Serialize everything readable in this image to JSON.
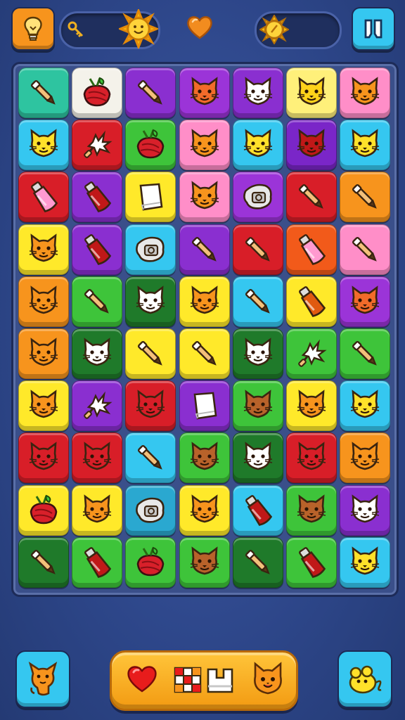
{
  "theme": {
    "bg": "#2d4689",
    "board": "#3a4f8a",
    "accent_orange": "#f7941d",
    "accent_cyan": "#35c7f0"
  },
  "top_bar": {
    "hint_button": {
      "icon": "lightbulb-icon",
      "color": "#f7941d"
    },
    "left_counter": {
      "icons": [
        "key-icon",
        "sun-icon"
      ]
    },
    "heart": {
      "icon": "heart-icon",
      "color": "#f28c1f"
    },
    "right_counter": {
      "icons": [
        "coin-icon"
      ]
    },
    "pause_button": {
      "icon": "pause-icon",
      "color": "#35c7f0"
    }
  },
  "board": {
    "rows": 10,
    "cols": 7,
    "tiles": [
      [
        [
          "#2ec4a0",
          "brush"
        ],
        [
          "#f4f2ea",
          "berry"
        ],
        [
          "#8a2fd0",
          "brush"
        ],
        [
          "#9b34d8",
          "cat"
        ],
        [
          "#8a2fd0",
          "cat"
        ],
        [
          "#fff07a",
          "cat"
        ],
        [
          "#ff8ec8",
          "cat"
        ]
      ],
      [
        [
          "#35c7f0",
          "cat"
        ],
        [
          "#d81e28",
          "splat"
        ],
        [
          "#3ec43a",
          "berry"
        ],
        [
          "#ff8ec8",
          "cat"
        ],
        [
          "#35c7f0",
          "cat"
        ],
        [
          "#7a26c8",
          "cat"
        ],
        [
          "#35c7f0",
          "cat"
        ]
      ],
      [
        [
          "#d81e28",
          "bottle"
        ],
        [
          "#8a2fd0",
          "bottle"
        ],
        [
          "#ffe92a",
          "paper"
        ],
        [
          "#ff8ec8",
          "cat"
        ],
        [
          "#9b34d8",
          "toy"
        ],
        [
          "#d81e28",
          "brush"
        ],
        [
          "#f7941d",
          "brush"
        ]
      ],
      [
        [
          "#ffe92a",
          "cat"
        ],
        [
          "#8a2fd0",
          "bottle"
        ],
        [
          "#35c7f0",
          "toy"
        ],
        [
          "#8a2fd0",
          "brush"
        ],
        [
          "#d81e28",
          "brush"
        ],
        [
          "#f25a1a",
          "bottle"
        ],
        [
          "#ff8ec8",
          "brush"
        ]
      ],
      [
        [
          "#f7941d",
          "cat"
        ],
        [
          "#3ec43a",
          "brush"
        ],
        [
          "#1f7a2a",
          "cat"
        ],
        [
          "#ffe92a",
          "cat"
        ],
        [
          "#35c7f0",
          "brush"
        ],
        [
          "#ffe92a",
          "bottle"
        ],
        [
          "#9b34d8",
          "cat"
        ]
      ],
      [
        [
          "#f7941d",
          "cat"
        ],
        [
          "#1f7a2a",
          "cat"
        ],
        [
          "#ffe92a",
          "brush"
        ],
        [
          "#ffe92a",
          "brush"
        ],
        [
          "#1f7a2a",
          "cat"
        ],
        [
          "#3ec43a",
          "splat"
        ],
        [
          "#3ec43a",
          "brush"
        ]
      ],
      [
        [
          "#ffe92a",
          "cat"
        ],
        [
          "#8a2fd0",
          "splat"
        ],
        [
          "#d81e28",
          "cat"
        ],
        [
          "#8a2fd0",
          "paper"
        ],
        [
          "#3ec43a",
          "cat"
        ],
        [
          "#ffe92a",
          "cat"
        ],
        [
          "#35c7f0",
          "cat"
        ]
      ],
      [
        [
          "#d81e28",
          "cat"
        ],
        [
          "#d81e28",
          "cat"
        ],
        [
          "#35c7f0",
          "brush"
        ],
        [
          "#3ec43a",
          "cat"
        ],
        [
          "#1f7a2a",
          "cat"
        ],
        [
          "#d81e28",
          "cat"
        ],
        [
          "#f7941d",
          "cat"
        ]
      ],
      [
        [
          "#ffe92a",
          "berry"
        ],
        [
          "#ffe92a",
          "cat"
        ],
        [
          "#2aa8d0",
          "toy"
        ],
        [
          "#ffe92a",
          "cat"
        ],
        [
          "#35c7f0",
          "bottle"
        ],
        [
          "#3ec43a",
          "cat"
        ],
        [
          "#8a2fd0",
          "cat"
        ]
      ],
      [
        [
          "#1f7a2a",
          "brush"
        ],
        [
          "#3ec43a",
          "bottle"
        ],
        [
          "#3ec43a",
          "berry"
        ],
        [
          "#3ec43a",
          "cat"
        ],
        [
          "#1f7a2a",
          "brush"
        ],
        [
          "#3ec43a",
          "bottle"
        ],
        [
          "#35c7f0",
          "cat"
        ]
      ]
    ]
  },
  "bottom_bar": {
    "left_button": {
      "icon": "cat-face-icon",
      "color": "#35c7f0"
    },
    "center_items": [
      "heart-icon",
      "grid-icon",
      "box-icon",
      "cat-face-icon"
    ],
    "right_button": {
      "icon": "mouse-toy-icon",
      "color": "#35c7f0"
    }
  }
}
